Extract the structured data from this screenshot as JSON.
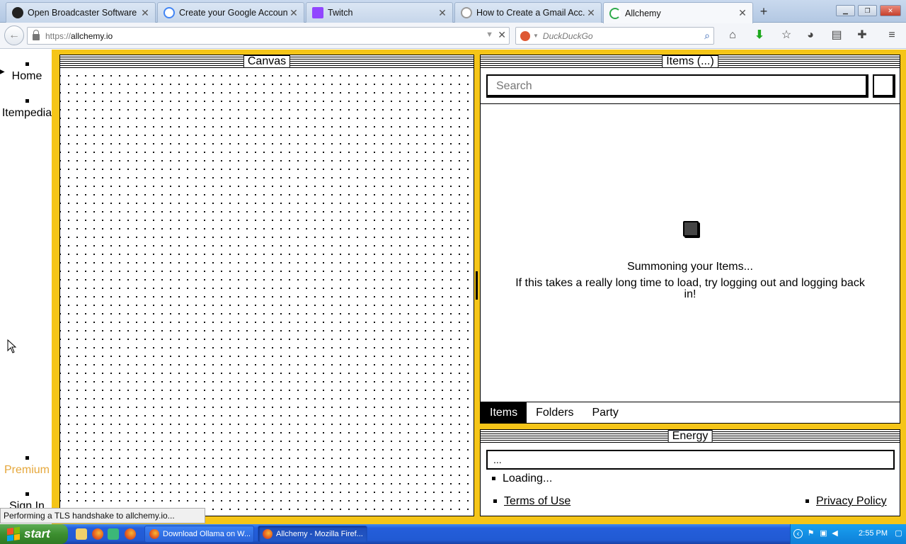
{
  "browser": {
    "tabs": [
      {
        "label": "Open Broadcaster Software ...",
        "icon": "obs-icon",
        "icon_color": "#222222"
      },
      {
        "label": "Create your Google Account",
        "icon": "google-icon",
        "icon_color": "#4285f4"
      },
      {
        "label": "Twitch",
        "icon": "twitch-icon",
        "icon_color": "#9146ff"
      },
      {
        "label": "How to Create a Gmail Acc...",
        "icon": "globe-icon",
        "icon_color": "#9a9a9a"
      },
      {
        "label": "Allchemy",
        "icon": "loading-spinner-icon",
        "icon_color": "#2eaa4a"
      }
    ],
    "active_tab": 4,
    "close_glyph": "✕",
    "new_tab_glyph": "+",
    "url": {
      "protocol": "https://",
      "host": "allchemy.io"
    },
    "search": {
      "engine": "DuckDuckGo",
      "placeholder": "DuckDuckGo"
    },
    "status": "Performing a TLS handshake to allchemy.io..."
  },
  "sidebar": {
    "items": [
      {
        "label": "Home"
      },
      {
        "label": "Itempedia"
      },
      {
        "label": "Premium",
        "color": "#e5a73b"
      },
      {
        "label": "Sign In"
      }
    ]
  },
  "canvas": {
    "title": "Canvas"
  },
  "items": {
    "title": "Items (...)",
    "search_placeholder": "Search",
    "loading_title": "Summoning your Items...",
    "loading_hint": "If this takes a really long time to load, try logging out and logging back in!",
    "tabs": [
      {
        "label": "Items",
        "active": true
      },
      {
        "label": "Folders",
        "active": false
      },
      {
        "label": "Party",
        "active": false
      }
    ]
  },
  "energy": {
    "title": "Energy",
    "value": "...",
    "status": "Loading...",
    "links": {
      "terms": "Terms of Use",
      "privacy": "Privacy Policy"
    }
  },
  "theme": {
    "accent": "#f5c518"
  },
  "taskbar": {
    "start_label": "start",
    "tasks": [
      {
        "label": "Download Ollama on W...",
        "active": false
      },
      {
        "label": "Allchemy - Mozilla Firef...",
        "active": true
      }
    ],
    "clock": "2:55 PM"
  }
}
